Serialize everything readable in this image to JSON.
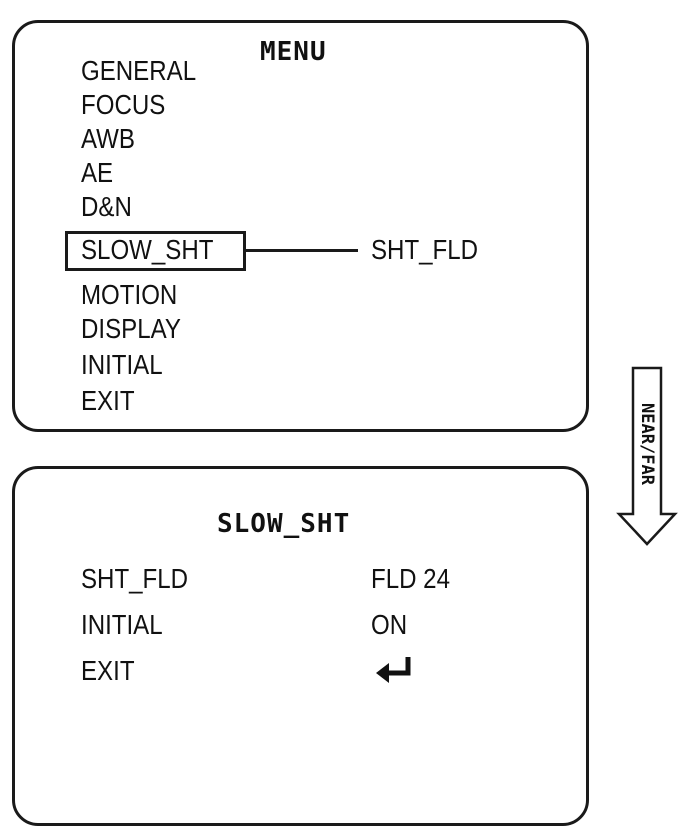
{
  "menu": {
    "title": "MENU",
    "items": [
      {
        "label": "GENERAL"
      },
      {
        "label": "FOCUS"
      },
      {
        "label": "AWB"
      },
      {
        "label": "AE"
      },
      {
        "label": "D&N"
      },
      {
        "label": "SLOW_SHT",
        "selected": true
      },
      {
        "label": "MOTION"
      },
      {
        "label": "DISPLAY"
      },
      {
        "label": "INITIAL"
      },
      {
        "label": "EXIT"
      }
    ],
    "submenu_preview": "SHT_FLD"
  },
  "submenu": {
    "title": "SLOW_SHT",
    "rows": [
      {
        "label": "SHT_FLD",
        "value": "FLD 24"
      },
      {
        "label": "INITIAL",
        "value": "ON"
      },
      {
        "label": "EXIT",
        "value": "",
        "icon": "enter-return-icon"
      }
    ]
  },
  "key_hint": {
    "label": "NEAR/FAR",
    "icon": "down-arrow-icon"
  }
}
